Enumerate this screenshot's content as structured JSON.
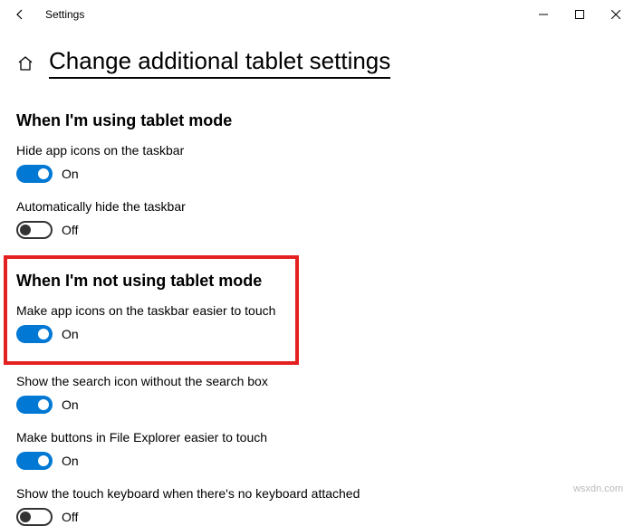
{
  "titlebar": {
    "title": "Settings"
  },
  "page_title": "Change additional tablet settings",
  "section1": {
    "heading": "When I'm using tablet mode",
    "settings": [
      {
        "label": "Hide app icons on the taskbar",
        "state": "On",
        "on": true
      },
      {
        "label": "Automatically hide the taskbar",
        "state": "Off",
        "on": false
      }
    ]
  },
  "section2": {
    "heading": "When I'm not using tablet mode",
    "settings": [
      {
        "label": "Make app icons on the taskbar easier to touch",
        "state": "On",
        "on": true
      },
      {
        "label": "Show the search icon without the search box",
        "state": "On",
        "on": true
      },
      {
        "label": "Make buttons in File Explorer easier to touch",
        "state": "On",
        "on": true
      },
      {
        "label": "Show the touch keyboard when there's no keyboard attached",
        "state": "Off",
        "on": false
      }
    ]
  },
  "watermark": "wsxdn.com"
}
